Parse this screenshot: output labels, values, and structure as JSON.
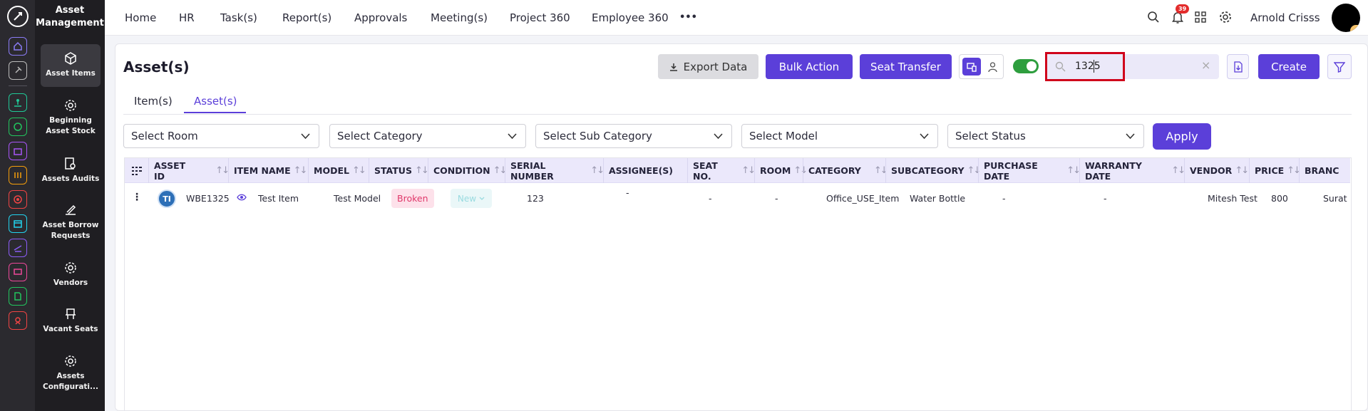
{
  "app": {
    "title_line1": "Asset",
    "title_line2": "Management"
  },
  "sidebar": {
    "items": [
      {
        "line1": "Asset Items",
        "line2": ""
      },
      {
        "line1": "Beginning",
        "line2": "Asset Stock"
      },
      {
        "line1": "Assets Audits",
        "line2": ""
      },
      {
        "line1": "Asset Borrow",
        "line2": "Requests"
      },
      {
        "line1": "Vendors",
        "line2": ""
      },
      {
        "line1": "Vacant Seats",
        "line2": ""
      },
      {
        "line1": "Assets",
        "line2": "Configurati..."
      }
    ]
  },
  "rail_icons": [
    {
      "icon": "home-icon",
      "color": "#8b7cf6"
    },
    {
      "icon": "pin-icon",
      "color": "#bbbbbb"
    },
    {
      "icon": "org-icon",
      "color": "#20c997"
    },
    {
      "icon": "box-icon",
      "color": "#22c55e"
    },
    {
      "icon": "briefcase-icon",
      "color": "#a855f7"
    },
    {
      "icon": "wallet-icon",
      "color": "#f59e0b"
    },
    {
      "icon": "target-icon",
      "color": "#ef4444"
    },
    {
      "icon": "archive-icon",
      "color": "#22d3ee"
    },
    {
      "icon": "plane-icon",
      "color": "#8b5cf6"
    },
    {
      "icon": "monitor-icon",
      "color": "#ec4899"
    },
    {
      "icon": "doc-icon",
      "color": "#22c55e"
    },
    {
      "icon": "support-icon",
      "color": "#ef4444"
    }
  ],
  "topnav": {
    "items": [
      "Home",
      "HR",
      "Task(s)",
      "Report(s)",
      "Approvals",
      "Meeting(s)",
      "Project 360",
      "Employee 360"
    ],
    "more": "•••",
    "notifications_count": "39",
    "user_name": "Arnold Crisss"
  },
  "page": {
    "title": "Asset(s)",
    "export_label": "Export Data",
    "bulk_label": "Bulk Action",
    "seat_label": "Seat Transfer",
    "search_value": "1325",
    "create_label": "Create",
    "tabs": [
      "Item(s)",
      "Asset(s)"
    ],
    "active_tab": "Asset(s)"
  },
  "filters": {
    "room": "Select Room",
    "category": "Select Category",
    "subcategory": "Select Sub Category",
    "model": "Select Model",
    "status": "Select Status",
    "apply": "Apply"
  },
  "table": {
    "columns": [
      "ASSET ID",
      "ITEM NAME",
      "MODEL",
      "STATUS",
      "CONDITION",
      "SERIAL NUMBER",
      "ASSIGNEE(S)",
      "SEAT NO.",
      "ROOM",
      "CATEGORY",
      "SUBCATEGORY",
      "PURCHASE DATE",
      "WARRANTY DATE",
      "VENDOR",
      "PRICE",
      "BRANC"
    ],
    "rows": [
      {
        "avatar": "TI",
        "asset_id": "WBE1325",
        "item_name": "Test Item",
        "model": "Test Model",
        "status": "Broken",
        "condition": "New",
        "serial": "123",
        "assignee": "-",
        "seat": "-",
        "room": "-",
        "category": "Office_USE_Item",
        "subcategory": "Water Bottle",
        "purchase_date": "-",
        "warranty_date": "-",
        "vendor": "Mitesh Test",
        "price": "800",
        "branch": "Surat"
      }
    ]
  },
  "colors": {
    "accent": "#5b3fd9",
    "highlight": "#d0021b",
    "toggle": "#2e9e3e"
  }
}
